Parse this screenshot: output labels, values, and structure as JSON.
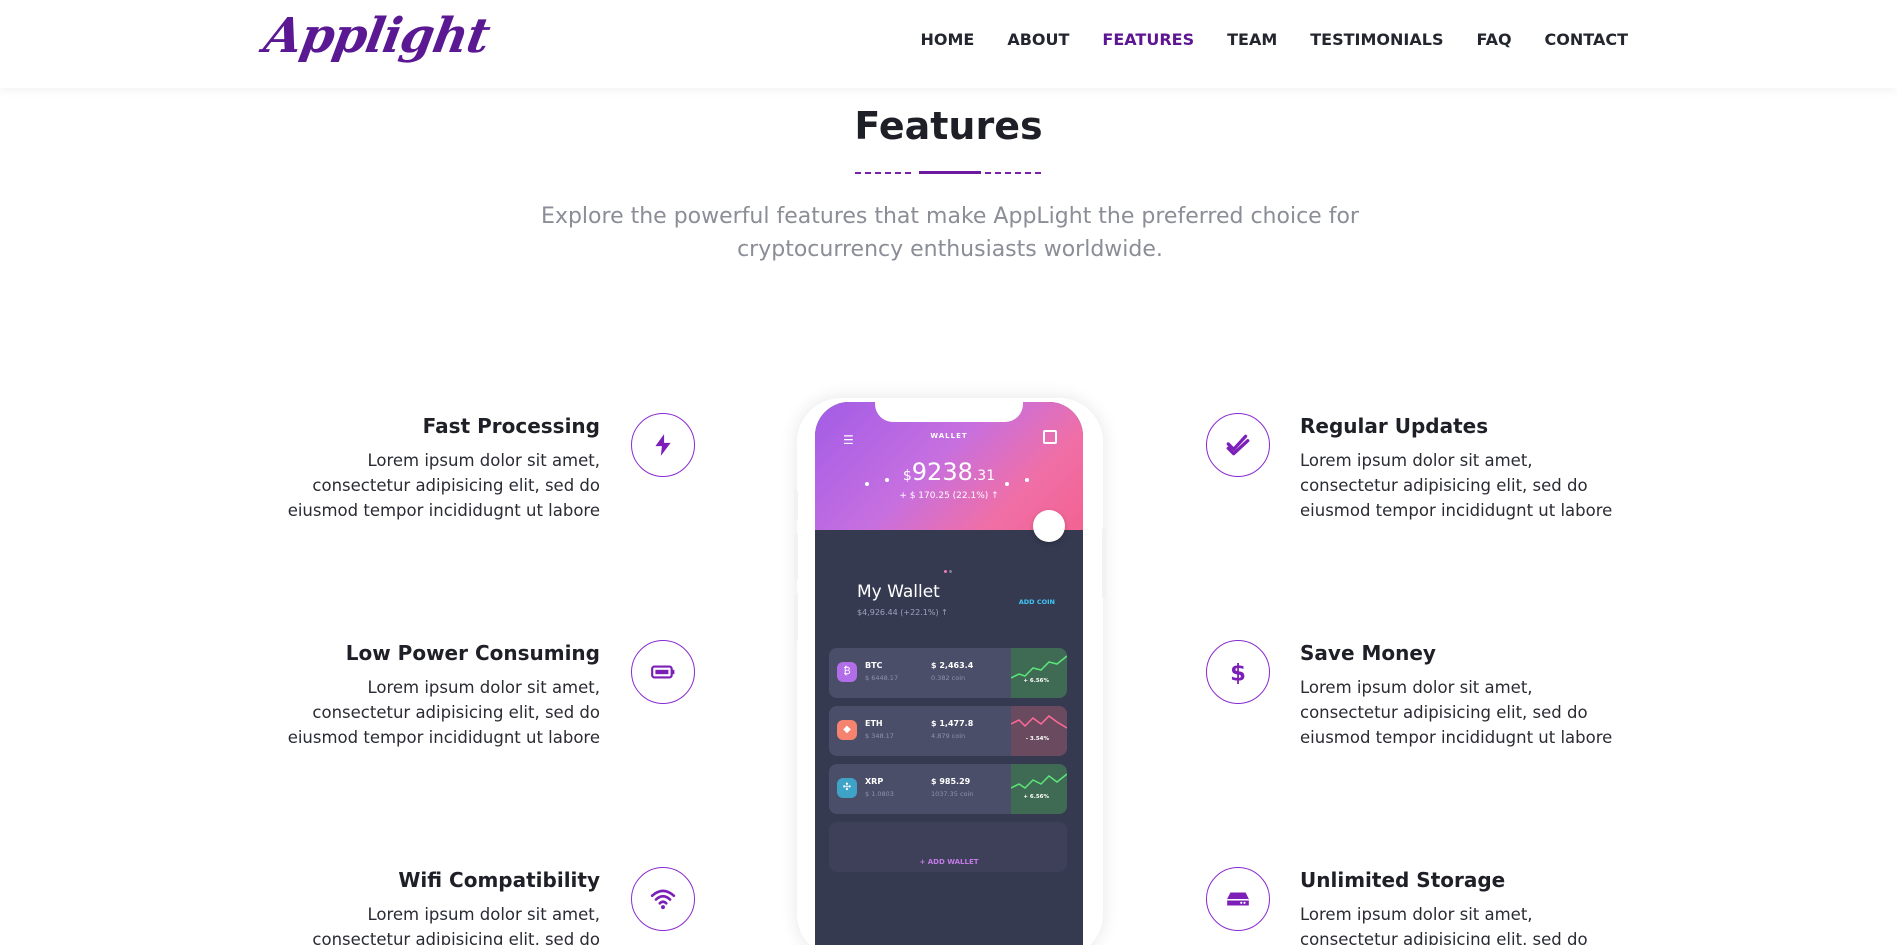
{
  "brand": {
    "logo_text": "Applight",
    "accent_color": "#5e1592"
  },
  "nav": {
    "items": [
      {
        "label": "HOME"
      },
      {
        "label": "ABOUT"
      },
      {
        "label": "FEATURES",
        "active": true
      },
      {
        "label": "TEAM"
      },
      {
        "label": "TESTIMONIALS"
      },
      {
        "label": "FAQ"
      },
      {
        "label": "CONTACT"
      }
    ]
  },
  "section": {
    "title": "Features",
    "subtitle": "Explore the powerful features that make AppLight the preferred choice for cryptocurrency enthusiasts worldwide."
  },
  "features": {
    "left": [
      {
        "title": "Fast Processing",
        "text": "Lorem ipsum dolor sit amet, consectetur adipisicing elit, sed do eiusmod tempor incididugnt ut labore",
        "icon": "bolt-icon"
      },
      {
        "title": "Low Power Consuming",
        "text": "Lorem ipsum dolor sit amet, consectetur adipisicing elit, sed do eiusmod tempor incididugnt ut labore",
        "icon": "battery-icon"
      },
      {
        "title": "Wifi Compatibility",
        "text": "Lorem ipsum dolor sit amet, consectetur adipisicing elit, sed do eiusmod tempor",
        "icon": "wifi-icon"
      }
    ],
    "right": [
      {
        "title": "Regular Updates",
        "text": "Lorem ipsum dolor sit amet, consectetur adipisicing elit, sed do eiusmod tempor incididugnt ut labore",
        "icon": "double-check-icon"
      },
      {
        "title": "Save Money",
        "text": "Lorem ipsum dolor sit amet, consectetur adipisicing elit, sed do eiusmod tempor incididugnt ut labore",
        "icon": "dollar-icon"
      },
      {
        "title": "Unlimited Storage",
        "text": "Lorem ipsum dolor sit amet, consectetur adipisicing elit, sed do eiusmod tempor",
        "icon": "storage-icon"
      }
    ]
  },
  "phone": {
    "header_label": "WALLET",
    "balance_main": "9238",
    "balance_cents": ".31",
    "balance_change": "+ $ 170.25 (22.1%) ↑",
    "wallet_title": "My Wallet",
    "wallet_sub": "$4,926.44 (+22.1%) ↑",
    "add_coin": "ADD COIN",
    "add_wallet": "+ ADD WALLET",
    "coins": [
      {
        "symbol": "BTC",
        "price": "$ 6448.17",
        "amount": "$ 2,463.4",
        "holding": "0.382 coin",
        "change": "+ 6.56%",
        "color": "#b26de8"
      },
      {
        "symbol": "ETH",
        "price": "$ 348.17",
        "amount": "$ 1,477.8",
        "holding": "4.879 coin",
        "change": "- 3.54%",
        "color": "#f5836f"
      },
      {
        "symbol": "XRP",
        "price": "$ 1.0803",
        "amount": "$ 985.29",
        "holding": "1037.35 coin",
        "change": "+ 6.56%",
        "color": "#3fa3c8"
      }
    ]
  }
}
